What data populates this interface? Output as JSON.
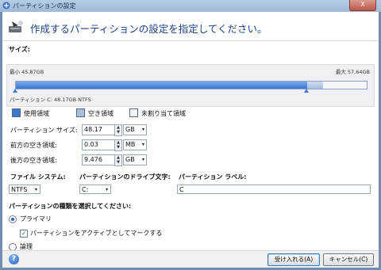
{
  "window": {
    "title": "パーティションの設定",
    "close_label": "X"
  },
  "header": {
    "instruction": "作成するパーティションの設定を指定してください。"
  },
  "size_section": {
    "label": "サイズ:",
    "min_label": "最小 45.87GB",
    "max_label": "最大 57.64GB",
    "partition_info": "パーティション C:  48.17GB  NTFS",
    "used_fraction": 0.83,
    "partition_fraction": 0.83
  },
  "legend": {
    "used": "使用領域",
    "free": "空き領域",
    "unallocated": "未割り当て領域"
  },
  "fields": {
    "partition_size": {
      "label": "パーティション サイズ:",
      "value": "48.17",
      "unit": "GB"
    },
    "space_before": {
      "label": "前方の空き領域:",
      "value": "0.03",
      "unit": "MB"
    },
    "space_after": {
      "label": "後方の空き領域:",
      "value": "9.476",
      "unit": "GB"
    }
  },
  "filesystem": {
    "label": "ファイル システム:",
    "value": "NTFS"
  },
  "drive_letter": {
    "label": "パーティションのドライブ文字:",
    "value": "C:"
  },
  "volume_label": {
    "label": "パーティション ラベル:",
    "value": "C"
  },
  "partition_type": {
    "label": "パーティションの種類を選択してください:",
    "primary": "プライマリ",
    "mark_active": "パーティションをアクティブとしてマークする",
    "logical": "論理"
  },
  "footer": {
    "ok_label": "受け入れる(A)",
    "cancel_label": "キャンセル(C)",
    "help_label": "?"
  },
  "colors": {
    "accent": "#3a76d2",
    "title_text": "#1b3f86",
    "used": "#3a76d2",
    "free": "#a8bfe0"
  }
}
